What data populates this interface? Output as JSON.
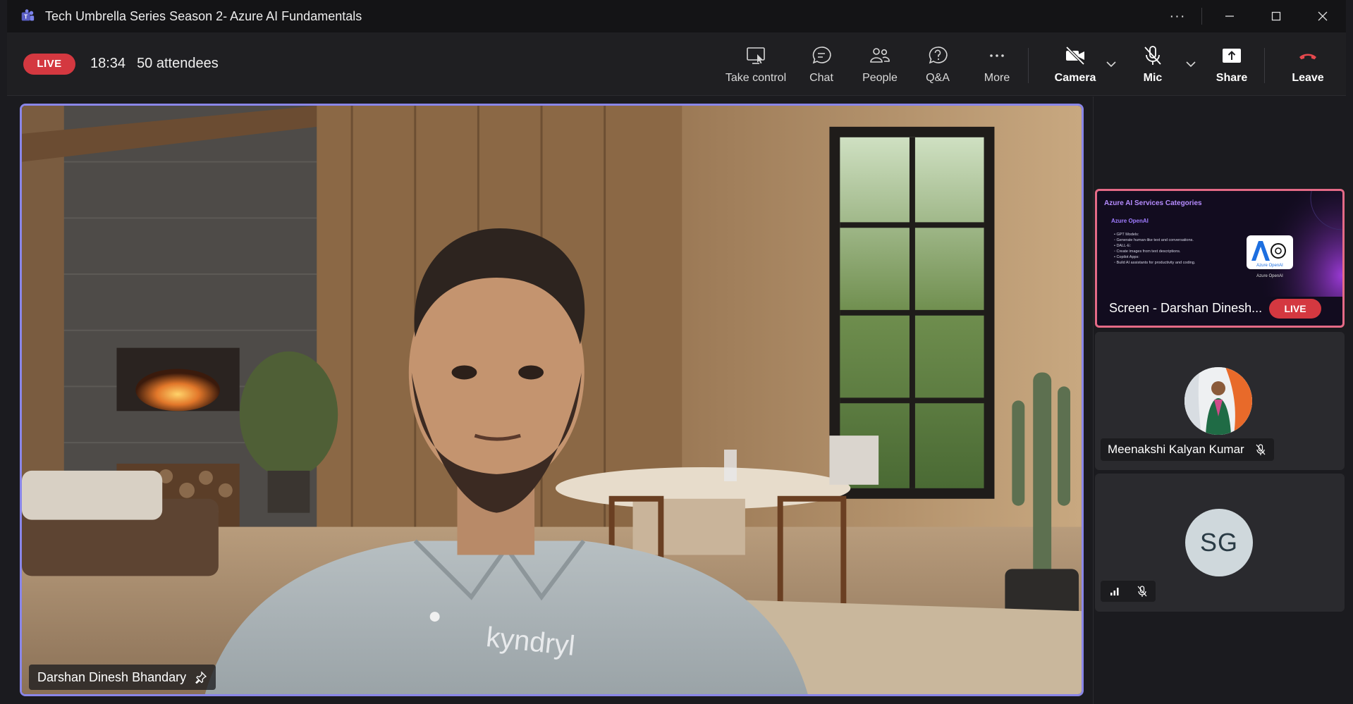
{
  "window": {
    "title": "Tech Umbrella Series Season 2- Azure AI Fundamentals",
    "controls": [
      "more-options",
      "minimize",
      "maximize",
      "close"
    ]
  },
  "meeting": {
    "live_label": "LIVE",
    "elapsed": "18:34",
    "attendees": "50 attendees"
  },
  "toolbar": {
    "take_control": "Take control",
    "chat": "Chat",
    "people": "People",
    "qa": "Q&A",
    "more": "More",
    "camera": "Camera",
    "mic": "Mic",
    "share": "Share",
    "leave": "Leave"
  },
  "main_video": {
    "speaker_name": "Darshan Dinesh Bhandary",
    "shirt_logo": "kyndryl"
  },
  "rail": {
    "screen_tile": {
      "slide_title": "Azure AI Services Categories",
      "slide_subtitle": "Azure OpenAI",
      "slide_lines": [
        "• GPT Models:",
        "   ◦ Generate human-like text and conversations.",
        "• DALL-E:",
        "   ◦ Create images from text descriptions.",
        "• Copilot Apps:",
        "   ◦ Build AI assistants for productivity and coding."
      ],
      "logo_caption": "Azure OpenAI",
      "logo_inner": "Azure OpenAI",
      "label": "Screen - Darshan Dinesh...",
      "live_label": "LIVE"
    },
    "participant_2": {
      "name": "Meenakshi Kalyan Kumar"
    },
    "participant_3": {
      "initials": "SG"
    }
  },
  "colors": {
    "live": "#d43840",
    "active_speaker_border": "#8a86e8",
    "screen_tile_border": "#e46a86",
    "leave_icon": "#e5484d"
  },
  "icons": [
    "teams-icon",
    "take-control-icon",
    "chat-icon",
    "people-icon",
    "qa-icon",
    "more-icon",
    "camera-off-icon",
    "mic-off-icon",
    "share-icon",
    "leave-phone-icon",
    "pin-icon",
    "signal-icon"
  ]
}
